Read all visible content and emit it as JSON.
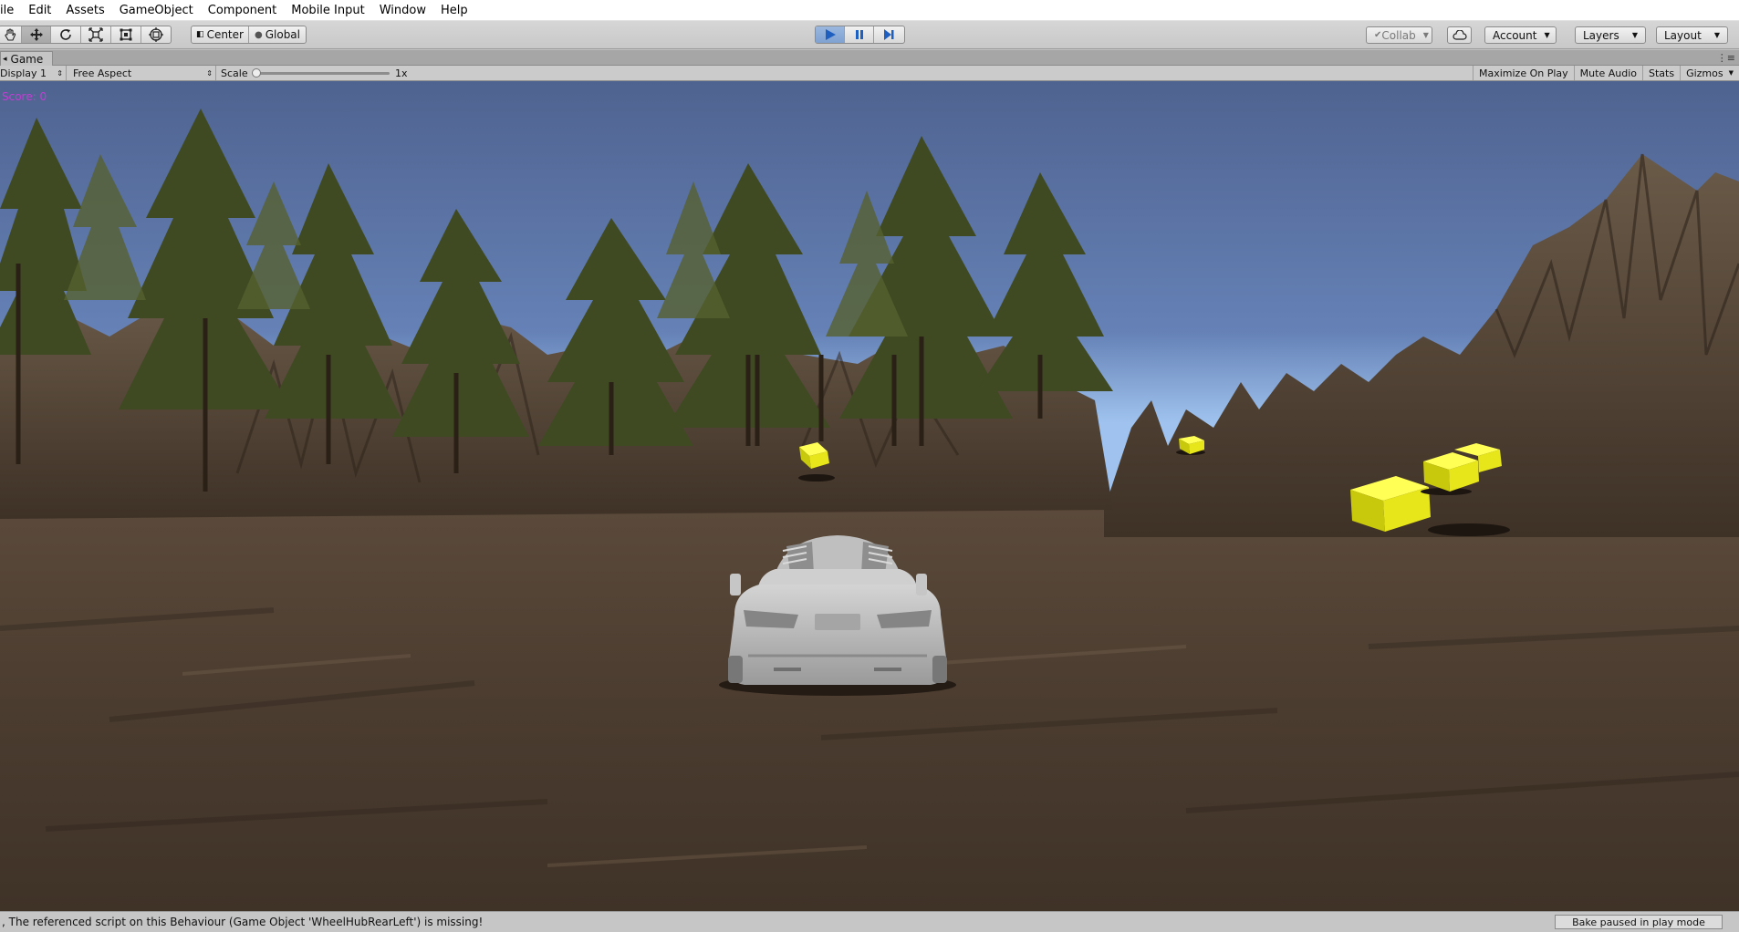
{
  "menu": [
    "ile",
    "Edit",
    "Assets",
    "GameObject",
    "Component",
    "Mobile Input",
    "Window",
    "Help"
  ],
  "toolbar": {
    "tools": [
      "hand-tool",
      "move-tool",
      "rotate-tool",
      "scale-tool",
      "rect-tool",
      "transform-tool"
    ],
    "pivot_label": "Center",
    "space_label": "Global",
    "playback": [
      "play",
      "pause",
      "step"
    ],
    "collab_label": "Collab",
    "account_label": "Account",
    "layers_label": "Layers",
    "layout_label": "Layout"
  },
  "tab": {
    "label": "Game"
  },
  "gamebar": {
    "display": "Display 1",
    "aspect": "Free Aspect",
    "scale_label": "Scale",
    "scale_value": "1x",
    "buttons": [
      "Maximize On Play",
      "Mute Audio",
      "Stats",
      "Gizmos"
    ]
  },
  "game": {
    "score_text": "Score: 0"
  },
  "status": {
    "message": ", The referenced script on this Behaviour (Game Object 'WheelHubRearLeft') is missing!",
    "bake": "Bake paused in play mode"
  },
  "colors": {
    "sky": "#5a6f99",
    "ground": "#5a4838",
    "cube": "#e6e61a",
    "score": "#c93ad6"
  }
}
